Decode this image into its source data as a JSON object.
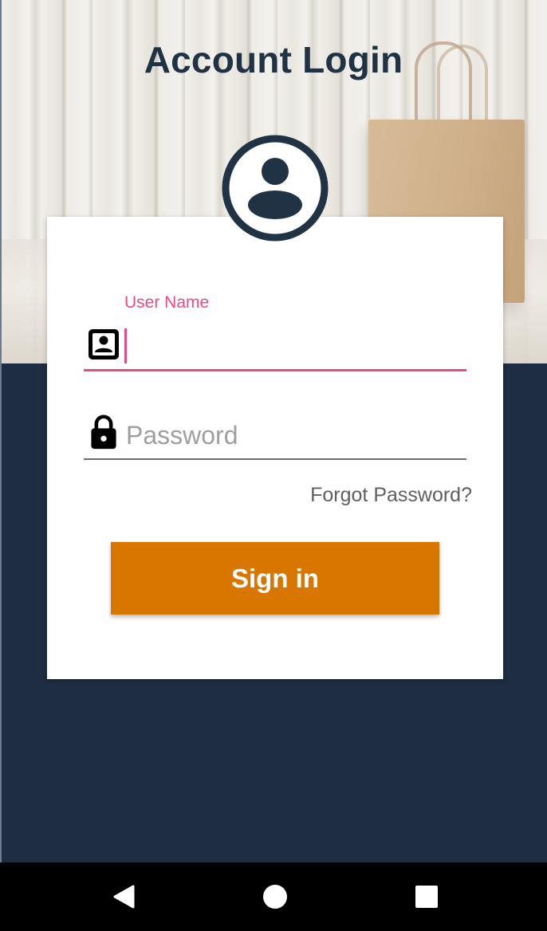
{
  "screen": {
    "title": "Account Login"
  },
  "login_form": {
    "username": {
      "label": "User Name",
      "value": "",
      "icon": "contact-card-icon"
    },
    "password": {
      "placeholder": "Password",
      "value": "",
      "icon": "lock-icon"
    },
    "forgot_password_label": "Forgot Password?",
    "signin_label": "Sign in"
  },
  "colors": {
    "accent": "#e84a84",
    "button": "#d97600",
    "title": "#1f3344",
    "background": "#1e2d41"
  },
  "navigation_bar": {
    "back_icon": "back-triangle-icon",
    "home_icon": "home-circle-icon",
    "recents_icon": "recents-square-icon"
  }
}
